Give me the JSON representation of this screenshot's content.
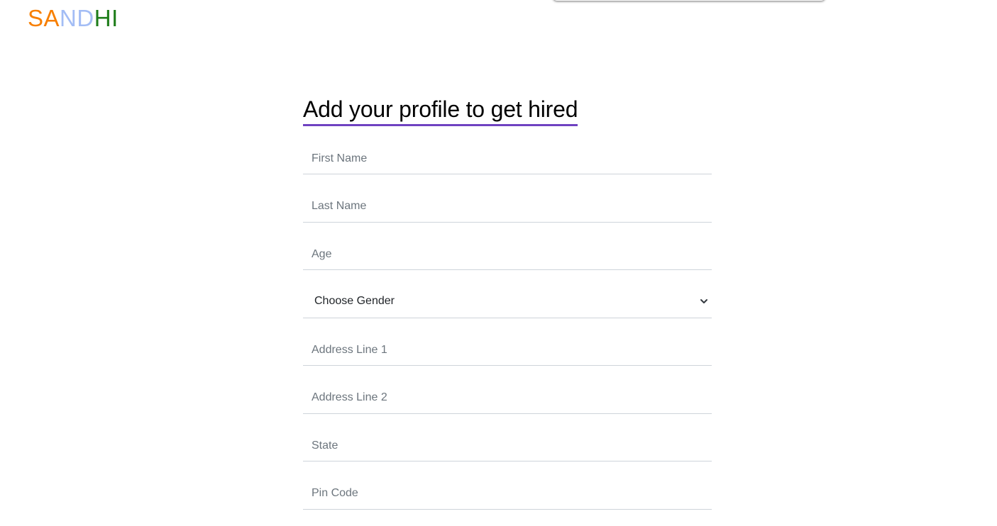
{
  "brand": {
    "letters": [
      {
        "char": "S",
        "color": "#f77f00"
      },
      {
        "char": "A",
        "color": "#f77f00"
      },
      {
        "char": "N",
        "color": "#a3bdf5"
      },
      {
        "char": "D",
        "color": "#a3bdf5"
      },
      {
        "char": "H",
        "color": "#1e7d1a"
      },
      {
        "char": "I",
        "color": "#1e7d1a"
      }
    ]
  },
  "form": {
    "heading": "Add your profile to get hired",
    "first_name": {
      "placeholder": "First Name",
      "value": ""
    },
    "last_name": {
      "placeholder": "Last Name",
      "value": ""
    },
    "age": {
      "placeholder": "Age",
      "value": ""
    },
    "gender": {
      "selected": "Choose Gender"
    },
    "address1": {
      "placeholder": "Address Line 1",
      "value": ""
    },
    "address2": {
      "placeholder": "Address Line 2",
      "value": ""
    },
    "state": {
      "placeholder": "State",
      "value": ""
    },
    "pin_code": {
      "placeholder": "Pin Code",
      "value": ""
    }
  },
  "colors": {
    "heading_underline": "#6f42c1",
    "field_border": "#ced4da",
    "placeholder": "#6c757d"
  }
}
